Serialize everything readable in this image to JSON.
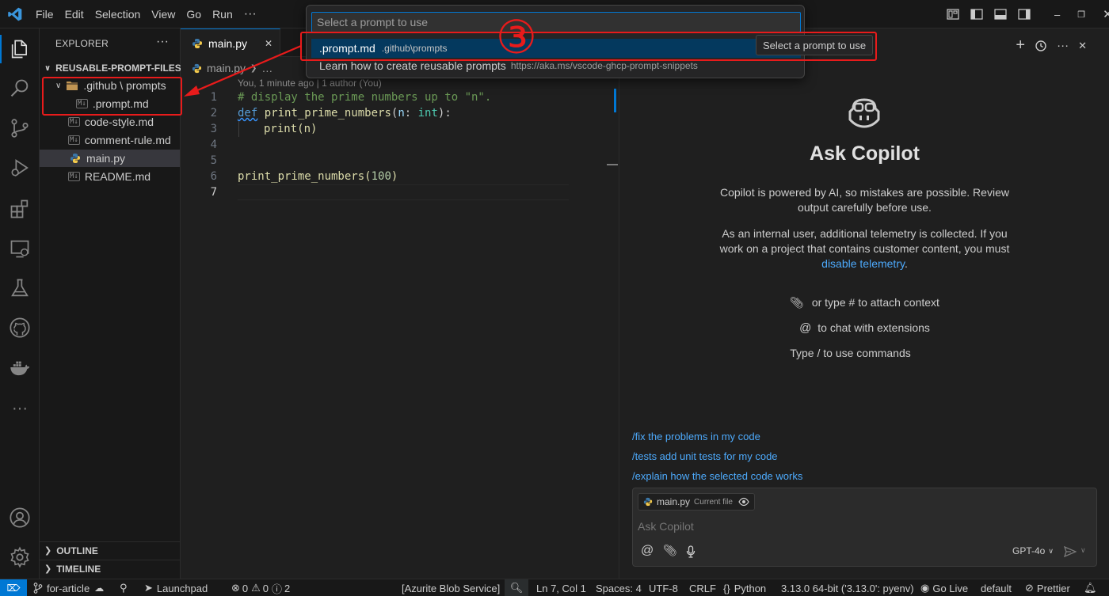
{
  "menu": [
    "File",
    "Edit",
    "Selection",
    "View",
    "Go",
    "Run",
    "···"
  ],
  "explorer": {
    "title": "EXPLORER",
    "more": "···",
    "project": "REUSABLE-PROMPT-FILES...",
    "items": [
      {
        "label": ".github \\ prompts",
        "type": "folder"
      },
      {
        "label": ".prompt.md",
        "type": "md",
        "badge": "M↓"
      },
      {
        "label": "code-style.md",
        "type": "md",
        "badge": "M↓"
      },
      {
        "label": "comment-rule.md",
        "type": "md",
        "badge": "M↓"
      },
      {
        "label": "main.py",
        "type": "py"
      },
      {
        "label": "README.md",
        "type": "md",
        "badge": "M↓"
      }
    ],
    "outline": "OUTLINE",
    "timeline": "TIMELINE"
  },
  "editor": {
    "tab_label": "main.py",
    "breadcrumb_file": "main.py",
    "breadcrumb_more": "…",
    "blame": "You, 1 minute ago | 1 author (You)",
    "line_numbers": [
      "1",
      "2",
      "3",
      "4",
      "5",
      "6",
      "7"
    ],
    "code": {
      "l1": "# display the prime numbers up to \"n\".",
      "l2_kw": "def",
      "l2_fn": "print_prime_numbers",
      "l2_p1": "(",
      "l2_param": "n",
      "l2_colon": ": ",
      "l2_type": "int",
      "l2_end": "):",
      "l3_fn": "print",
      "l3_rest": "(n)",
      "l6_fn": "print_prime_numbers",
      "l6_p1": "(",
      "l6_num": "100",
      "l6_p2": ")"
    }
  },
  "quickpick": {
    "placeholder": "Select a prompt to use",
    "item1_label": ".prompt.md",
    "item1_desc": ".github\\prompts",
    "item2_label": "Learn how to create reusable prompts",
    "item2_desc": "https://aka.ms/vscode-ghcp-prompt-snippets",
    "tooltip": "Select a prompt to use"
  },
  "annotation": {
    "step_number": "③",
    "color": "#e81b1b"
  },
  "chat": {
    "title": "Ask Copilot",
    "disclaimer_1": "Copilot is powered by AI, so mistakes are possible. Review",
    "disclaimer_2": "output carefully before use.",
    "telemetry_1": "As an internal user, additional telemetry is collected. If you",
    "telemetry_2": "work on a project that contains customer content, you must",
    "telemetry_link": "disable telemetry",
    "telemetry_end": ".",
    "hint_attach": "or type # to attach context",
    "hint_ext": "to chat with extensions",
    "hint_cmd": "Type / to use commands",
    "suggestions": [
      "/fix the problems in my code",
      "/tests add unit tests for my code",
      "/explain how the selected code works"
    ],
    "context_file": "main.py",
    "context_label": "Current file",
    "input_placeholder": "Ask Copilot",
    "model": "GPT-4o",
    "at_symbol": "@"
  },
  "statusbar": {
    "branch": "for-article",
    "launchpad": "Launchpad",
    "errors": "0",
    "warnings": "0",
    "info": "2",
    "azurite": "[Azurite Blob Service]",
    "position": "Ln 7, Col 1",
    "spaces": "Spaces: 4",
    "encoding": "UTF-8",
    "eol": "CRLF",
    "language": "Python",
    "interpreter": "3.13.0 64-bit ('3.13.0': pyenv)",
    "golive": "Go Live",
    "profile": "default",
    "prettier": "Prettier"
  },
  "colors": {
    "accent": "#0078d4",
    "link": "#4daafc",
    "comment": "#6a9955",
    "keyword": "#569cd6",
    "function": "#dcdcaa",
    "type": "#4ec9b0",
    "param": "#9cdcfe",
    "number": "#b5cea8"
  }
}
